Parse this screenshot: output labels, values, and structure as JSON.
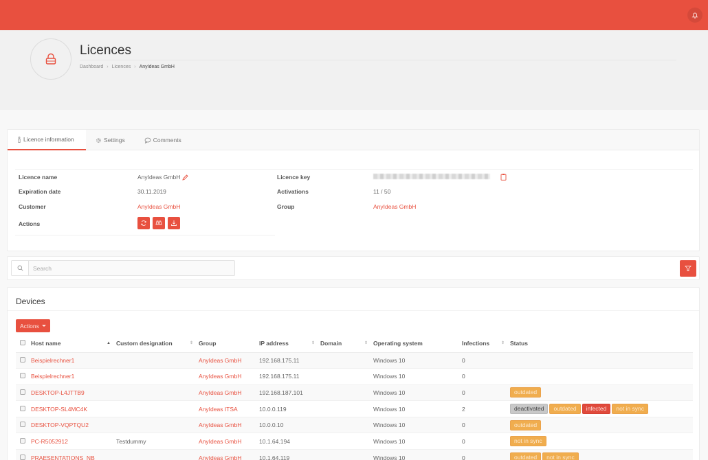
{
  "topbar": {
    "bell_icon": "bell-icon",
    "accent": "#e8503f"
  },
  "header": {
    "icon": "lock-icon",
    "title": "Licences",
    "breadcrumb": [
      {
        "label": "Dashboard"
      },
      {
        "label": "Licences"
      },
      {
        "label": "AnyIdeas GmbH"
      }
    ]
  },
  "tabs": [
    {
      "label": "Licence information",
      "icon": "info-icon",
      "active": true
    },
    {
      "label": "Settings",
      "icon": "gear-icon",
      "active": false
    },
    {
      "label": "Comments",
      "icon": "comment-icon",
      "active": false
    }
  ],
  "licence_info": {
    "licence_name": {
      "label": "Licence name",
      "value": "AnyIdeas GmbH"
    },
    "expiration_date": {
      "label": "Expiration date",
      "value": "30.11.2019"
    },
    "customer": {
      "label": "Customer",
      "value": "AnyIdeas GmbH"
    },
    "actions": {
      "label": "Actions",
      "buttons": [
        "refresh-icon",
        "binoculars-icon",
        "download-icon"
      ]
    },
    "licence_key": {
      "label": "Licence key",
      "value": "(blurred)"
    },
    "activations": {
      "label": "Activations",
      "value": "11 / 50"
    },
    "group": {
      "label": "Group",
      "value": "AnyIdeas GmbH"
    }
  },
  "search": {
    "placeholder": "Search",
    "value": ""
  },
  "devices": {
    "title": "Devices",
    "actions_label": "Actions",
    "columns": [
      "Host name",
      "Custom designation",
      "Group",
      "IP address",
      "Domain",
      "Operating system",
      "Infections",
      "Status"
    ],
    "rows": [
      {
        "host": "Beispielrechner1",
        "custom": "",
        "group": "AnyIdeas GmbH",
        "ip": "192.168.175.11",
        "domain": "",
        "os": "Windows 10",
        "infections": "0",
        "status": []
      },
      {
        "host": "Beispielrechner1",
        "custom": "",
        "group": "AnyIdeas GmbH",
        "ip": "192.168.175.11",
        "domain": "",
        "os": "Windows 10",
        "infections": "0",
        "status": []
      },
      {
        "host": "DESKTOP-L4JTTB9",
        "custom": "",
        "group": "AnyIdeas GmbH",
        "ip": "192.168.187.101",
        "domain": "",
        "os": "Windows 10",
        "infections": "0",
        "status": [
          "outdated"
        ]
      },
      {
        "host": "DESKTOP-SL4MC4K",
        "custom": "",
        "group": "AnyIdeas ITSA",
        "ip": "10.0.0.119",
        "domain": "",
        "os": "Windows 10",
        "infections": "2",
        "status": [
          "deactivated",
          "outdated",
          "infected",
          "not in sync"
        ]
      },
      {
        "host": "DESKTOP-VQPTQU2",
        "custom": "",
        "group": "AnyIdeas GmbH",
        "ip": "10.0.0.10",
        "domain": "",
        "os": "Windows 10",
        "infections": "0",
        "status": [
          "outdated"
        ]
      },
      {
        "host": "PC-R5052912",
        "custom": "Testdummy",
        "group": "AnyIdeas GmbH",
        "ip": "10.1.64.194",
        "domain": "",
        "os": "Windows 10",
        "infections": "0",
        "status": [
          "not in sync"
        ]
      },
      {
        "host": "PRAESENTATIONS_NB",
        "custom": "",
        "group": "AnyIdeas GmbH",
        "ip": "10.1.64.119",
        "domain": "",
        "os": "Windows 10",
        "infections": "0",
        "status": [
          "outdated",
          "not in sync"
        ]
      }
    ]
  }
}
